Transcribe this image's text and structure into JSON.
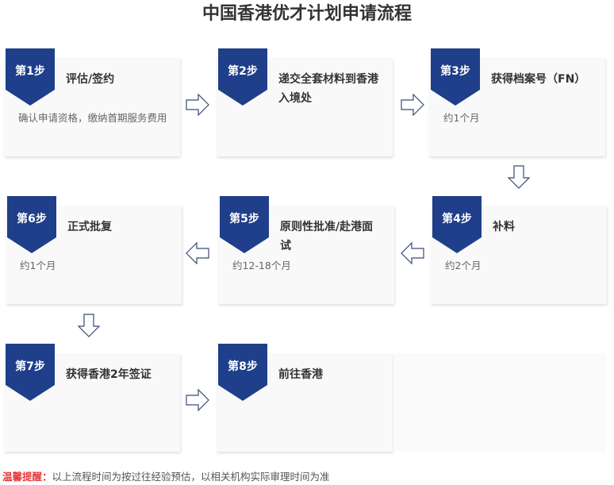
{
  "title": "中国香港优才计划申请流程",
  "colors": {
    "badge": "#1f3f8a",
    "card": "#f9f9f9",
    "notice_label": "#e4393c",
    "arrow": "#3a4b78"
  },
  "steps": [
    {
      "badge": "第1步",
      "title": "评估/签约",
      "desc": "确认申请资格，缴纳首期服务费用"
    },
    {
      "badge": "第2步",
      "title": "递交全套材料到香港入境处",
      "desc": ""
    },
    {
      "badge": "第3步",
      "title": "获得档案号（FN）",
      "desc": "约1个月"
    },
    {
      "badge": "第4步",
      "title": "补料",
      "desc": "约2个月"
    },
    {
      "badge": "第5步",
      "title": "原则性批准/赴港面试",
      "desc": "约12-18个月"
    },
    {
      "badge": "第6步",
      "title": "正式批复",
      "desc": "约1个月"
    },
    {
      "badge": "第7步",
      "title": "获得香港2年签证",
      "desc": ""
    },
    {
      "badge": "第8步",
      "title": "前往香港",
      "desc": ""
    }
  ],
  "notice": {
    "label": "温馨提醒：",
    "text": "以上流程时间为按过往经验预估，以相关机构实际审理时间为准"
  }
}
